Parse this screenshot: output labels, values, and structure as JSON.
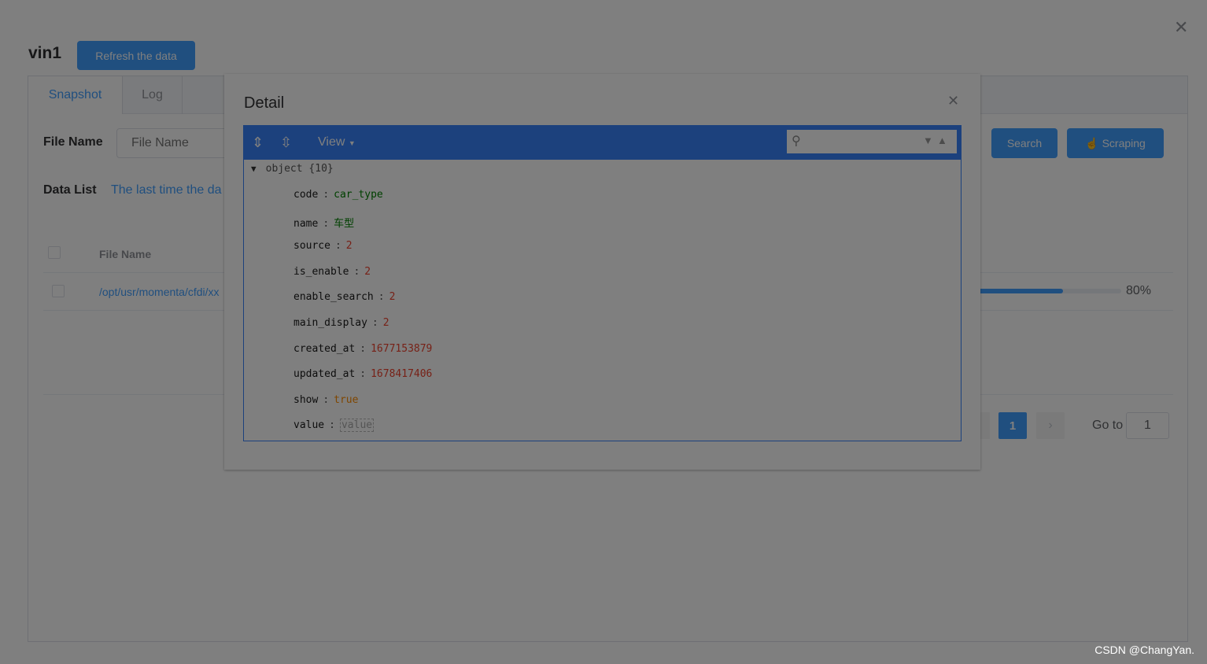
{
  "header": {
    "title": "vin1",
    "refresh_label": "Refresh the data"
  },
  "tabs": [
    {
      "label": "Snapshot",
      "active": true
    },
    {
      "label": "Log",
      "active": false
    }
  ],
  "form": {
    "file_name_label": "File Name",
    "file_name_placeholder": "File Name",
    "search_label": "Search",
    "scraping_label": "Scraping"
  },
  "data_list": {
    "label": "Data List",
    "last_time_text": "The last time the da"
  },
  "table": {
    "columns": [
      "File Name"
    ],
    "rows": [
      {
        "file_name": "/opt/usr/momenta/cfdi/xx",
        "progress_percent": 80,
        "progress_label": "80%"
      }
    ]
  },
  "pagination": {
    "current_page": "1",
    "goto_label": "Go to",
    "goto_value": "1"
  },
  "dialog": {
    "title": "Detail",
    "editor": {
      "view_label": "View",
      "root_label": "object {10}",
      "fields": [
        {
          "key": "code",
          "value": "car_type",
          "type": "str"
        },
        {
          "key": "name",
          "value": "车型",
          "type": "str"
        },
        {
          "key": "source",
          "value": "2",
          "type": "num"
        },
        {
          "key": "is_enable",
          "value": "2",
          "type": "num"
        },
        {
          "key": "enable_search",
          "value": "2",
          "type": "num"
        },
        {
          "key": "main_display",
          "value": "2",
          "type": "num"
        },
        {
          "key": "created_at",
          "value": "1677153879",
          "type": "num"
        },
        {
          "key": "updated_at",
          "value": "1678417406",
          "type": "num"
        },
        {
          "key": "show",
          "value": "true",
          "type": "bool"
        },
        {
          "key": "value",
          "value": "value",
          "type": "nullv"
        }
      ]
    }
  },
  "watermark": "CSDN @ChangYan.",
  "colors": {
    "primary": "#409eff",
    "editor_accent": "#3883fa"
  }
}
